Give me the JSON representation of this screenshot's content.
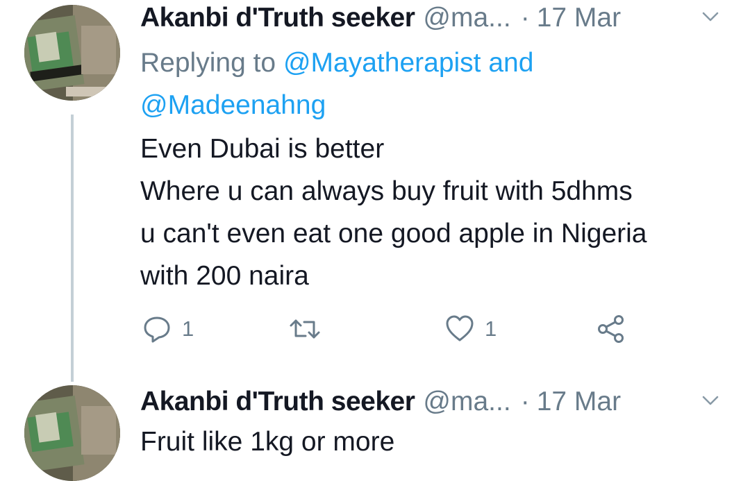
{
  "tweets": [
    {
      "author_name": "Akanbi d'Truth seeker",
      "handle": "@ma...",
      "separator": "·",
      "date": "17 Mar",
      "replying_prefix": "Replying to",
      "replying_mention_1": "@Mayatherapist",
      "replying_and": "and",
      "replying_mention_2": "@Madeenahng",
      "body_lines": [
        "Even Dubai is better",
        "Where u can always buy fruit with 5dhms",
        "u can't even eat one good apple in Nigeria",
        "with 200 naira"
      ],
      "reply_count": "1",
      "like_count": "1",
      "icons": {
        "reply": "reply-icon",
        "retweet": "retweet-icon",
        "like": "heart-icon",
        "share": "share-icon",
        "menu": "chevron-down-icon"
      }
    },
    {
      "author_name": "Akanbi d'Truth seeker",
      "handle": "@ma...",
      "separator": "·",
      "date": "17 Mar",
      "body_lines": [
        "Fruit like 1kg or more"
      ]
    }
  ],
  "colors": {
    "text_primary": "#141823",
    "text_secondary": "#687b8a",
    "link": "#1da1f2",
    "thread_line": "#c4cfd6"
  }
}
